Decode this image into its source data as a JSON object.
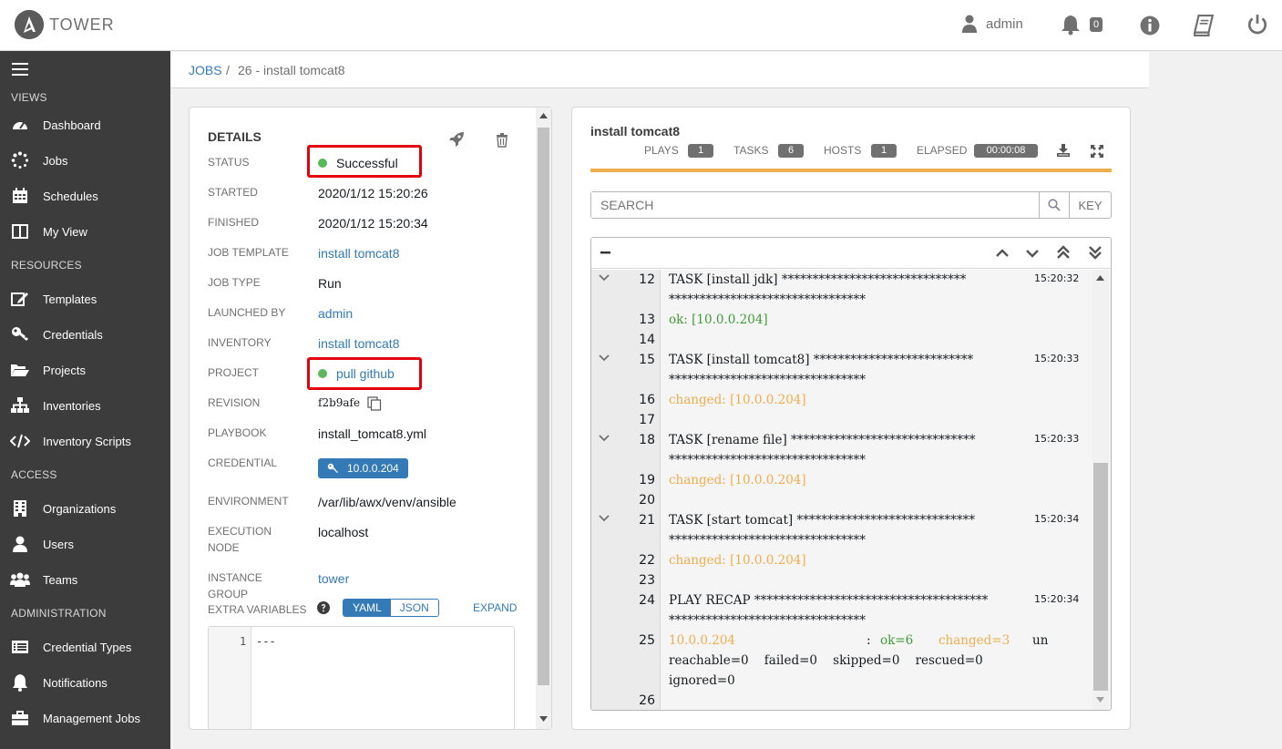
{
  "app": {
    "brand": "TOWER"
  },
  "topbar": {
    "user": "admin",
    "notification_count": "0"
  },
  "sidebar": {
    "sections": [
      {
        "title": "VIEWS",
        "items": [
          "Dashboard",
          "Jobs",
          "Schedules",
          "My View"
        ]
      },
      {
        "title": "RESOURCES",
        "items": [
          "Templates",
          "Credentials",
          "Projects",
          "Inventories",
          "Inventory Scripts"
        ]
      },
      {
        "title": "ACCESS",
        "items": [
          "Organizations",
          "Users",
          "Teams"
        ]
      },
      {
        "title": "ADMINISTRATION",
        "items": [
          "Credential Types",
          "Notifications",
          "Management Jobs"
        ]
      }
    ]
  },
  "breadcrumb": {
    "root": "JOBS",
    "sep": "/",
    "current": "26 - install tomcat8"
  },
  "details": {
    "title": "DETAILS",
    "status": {
      "label": "STATUS",
      "value": "Successful"
    },
    "started": {
      "label": "STARTED",
      "value": "2020/1/12 15:20:26"
    },
    "finished": {
      "label": "FINISHED",
      "value": "2020/1/12 15:20:34"
    },
    "job_template": {
      "label": "JOB TEMPLATE",
      "value": "install tomcat8"
    },
    "job_type": {
      "label": "JOB TYPE",
      "value": "Run"
    },
    "launched_by": {
      "label": "LAUNCHED BY",
      "value": "admin"
    },
    "inventory": {
      "label": "INVENTORY",
      "value": "install tomcat8"
    },
    "project": {
      "label": "PROJECT",
      "value": "pull github"
    },
    "revision": {
      "label": "REVISION",
      "value": "f2b9afe"
    },
    "playbook": {
      "label": "PLAYBOOK",
      "value": "install_tomcat8.yml"
    },
    "credential": {
      "label": "CREDENTIAL",
      "value": "10.0.0.204"
    },
    "environment": {
      "label": "ENVIRONMENT",
      "value": "/var/lib/awx/venv/ansible"
    },
    "execution_node": {
      "label_1": "EXECUTION",
      "label_2": "NODE",
      "value": "localhost"
    },
    "instance_group": {
      "label": "INSTANCE GROUP",
      "value": "tower"
    },
    "extra_variables": {
      "label": "EXTRA VARIABLES",
      "yaml": "YAML",
      "json": "JSON",
      "expand": "EXPAND",
      "line_no": "1",
      "code": "---"
    }
  },
  "output": {
    "title": "install tomcat8",
    "stats": {
      "plays_label": "PLAYS",
      "plays": "1",
      "tasks_label": "TASKS",
      "tasks": "6",
      "hosts_label": "HOSTS",
      "hosts": "1",
      "elapsed_label": "ELAPSED",
      "elapsed": "00:00:08"
    },
    "search_placeholder": "SEARCH",
    "key_label": "KEY",
    "lines": [
      {
        "n": "12",
        "text": "TASK [install jdk] ******************************",
        "cont": "********************************",
        "ts": "15:20:32",
        "kind": "task"
      },
      {
        "n": "13",
        "text": "ok: [10.0.0.204]",
        "kind": "ok"
      },
      {
        "n": "14",
        "text": "",
        "kind": "blank"
      },
      {
        "n": "15",
        "text": "TASK [install tomcat8] **************************",
        "cont": "********************************",
        "ts": "15:20:33",
        "kind": "task"
      },
      {
        "n": "16",
        "text": "changed: [10.0.0.204]",
        "kind": "changed"
      },
      {
        "n": "17",
        "text": "",
        "kind": "blank"
      },
      {
        "n": "18",
        "text": "TASK [rename file] ******************************",
        "cont": "********************************",
        "ts": "15:20:33",
        "kind": "task"
      },
      {
        "n": "19",
        "text": "changed: [10.0.0.204]",
        "kind": "changed"
      },
      {
        "n": "20",
        "text": "",
        "kind": "blank"
      },
      {
        "n": "21",
        "text": "TASK [start tomcat] *****************************",
        "cont": "********************************",
        "ts": "15:20:34",
        "kind": "task"
      },
      {
        "n": "22",
        "text": "changed: [10.0.0.204]",
        "kind": "changed"
      },
      {
        "n": "23",
        "text": "",
        "kind": "blank"
      },
      {
        "n": "24",
        "text": "PLAY RECAP **************************************",
        "cont": "********************************",
        "ts": "15:20:34",
        "kind": "task"
      }
    ],
    "recap": {
      "n": "25",
      "host": "10.0.0.204",
      "colon": ":",
      "ok": "ok=6",
      "changed": "changed=3",
      "un": "un",
      "line2": "reachable=0    failed=0    skipped=0    rescued=0",
      "line3": "ignored=0"
    },
    "last_line": "26"
  }
}
